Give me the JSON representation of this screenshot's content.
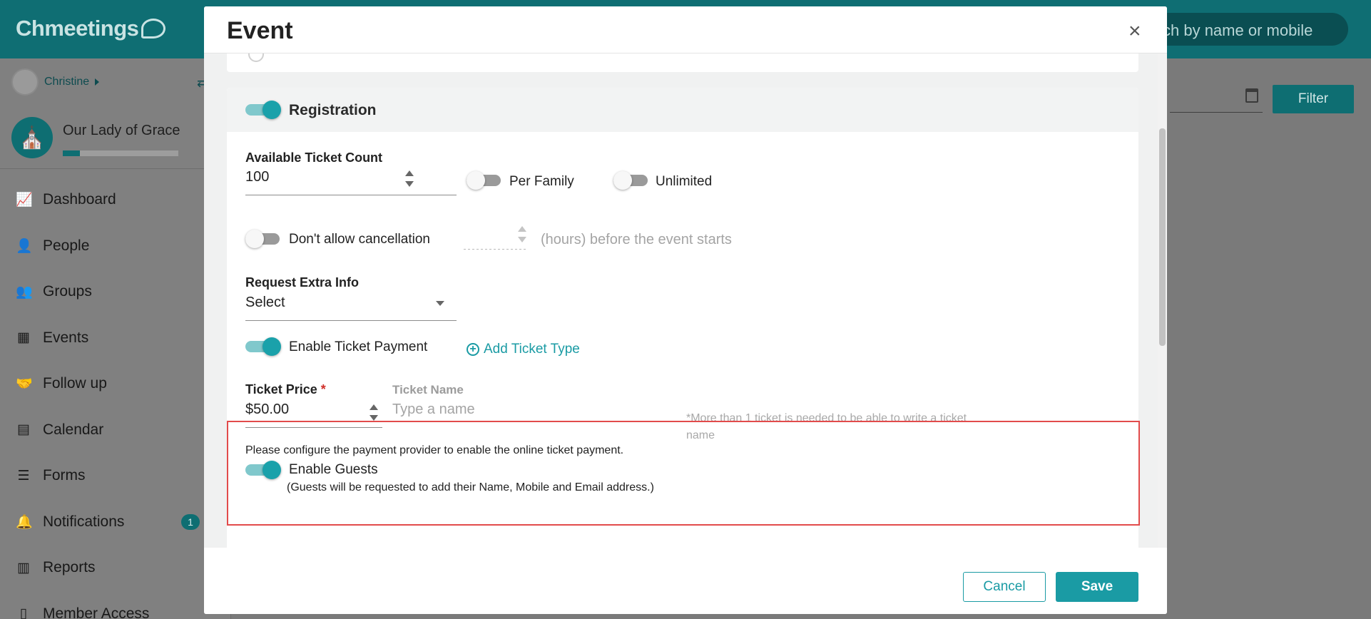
{
  "app": {
    "logo_text": "Chmeetings",
    "search_placeholder": "ch by name or mobile",
    "filter_label": "Filter"
  },
  "sidebar": {
    "user_name": "Christine",
    "church_name": "Our Lady of Grace",
    "church_progress": 0.15,
    "items": [
      {
        "label": "Dashboard",
        "icon": "chart-line-icon"
      },
      {
        "label": "People",
        "icon": "person-icon"
      },
      {
        "label": "Groups",
        "icon": "users-icon"
      },
      {
        "label": "Events",
        "icon": "calendar-icon"
      },
      {
        "label": "Follow up",
        "icon": "handshake-icon"
      },
      {
        "label": "Calendar",
        "icon": "calendar-grid-icon"
      },
      {
        "label": "Forms",
        "icon": "list-icon"
      },
      {
        "label": "Notifications",
        "icon": "bell-icon",
        "badge": "1"
      },
      {
        "label": "Reports",
        "icon": "bar-chart-icon"
      },
      {
        "label": "Member Access",
        "icon": "mobile-icon"
      }
    ]
  },
  "modal": {
    "title": "Event",
    "close_glyph": "×",
    "registration": {
      "title": "Registration",
      "enabled": true,
      "ticket_count_label": "Available Ticket Count",
      "ticket_count_value": "100",
      "per_family_label": "Per Family",
      "per_family_on": false,
      "unlimited_label": "Unlimited",
      "unlimited_on": false,
      "cancellation_label": "Don't allow cancellation",
      "cancellation_on": false,
      "hours_suffix": "(hours) before the event starts",
      "extra_info_label": "Request Extra Info",
      "extra_info_value": "Select",
      "ticket_payment_label": "Enable Ticket Payment",
      "ticket_payment_on": true,
      "add_ticket_type_label": "Add Ticket Type",
      "ticket_price_label": "Ticket Price",
      "required_marker": "*",
      "ticket_price_value": "$50.00",
      "ticket_name_label": "Ticket Name",
      "ticket_name_placeholder": "Type a name",
      "ticket_name_note": "*More than 1 ticket is needed to be able to write a ticket name",
      "payment_provider_msg": "Please configure the payment provider to enable the online ticket payment.",
      "guests_label": "Enable Guests",
      "guests_on": true,
      "guests_note": "(Guests will be requested to add their Name, Mobile and Email address.)"
    },
    "footer": {
      "cancel_label": "Cancel",
      "save_label": "Save"
    }
  },
  "colors": {
    "accent": "#1a9ba4",
    "brand_dark": "#0f6e73",
    "highlight_border": "#e24b4b",
    "required": "#d0302a"
  }
}
